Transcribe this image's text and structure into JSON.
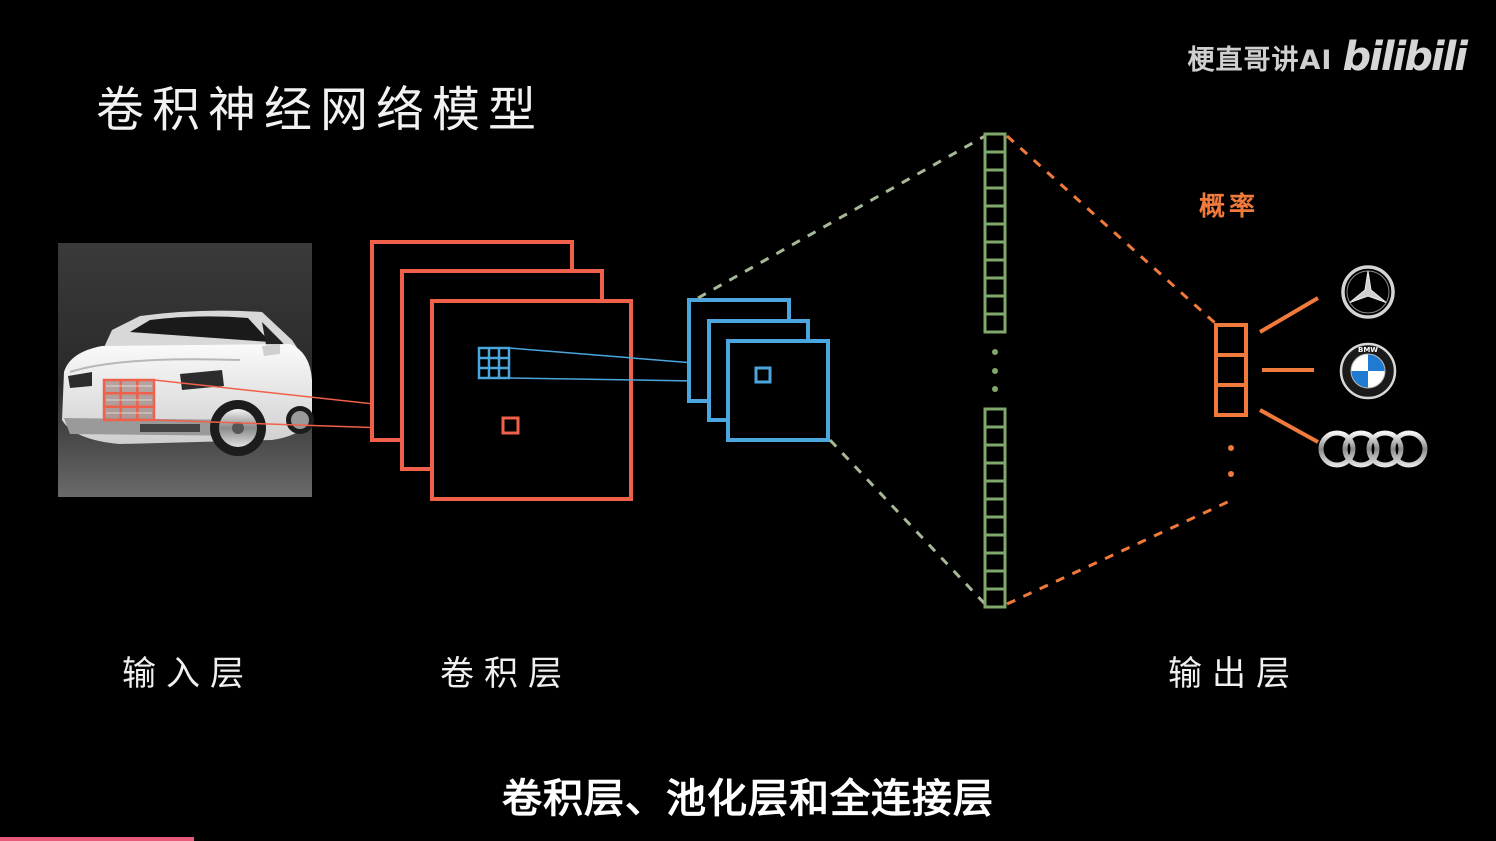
{
  "title": "卷积神经网络模型",
  "watermark": {
    "author": "梗直哥讲AI",
    "platform_logo": "bilibili"
  },
  "labels": {
    "input_layer": "输入层",
    "conv_layer": "卷积层",
    "output_layer": "输出层",
    "probability": "概率"
  },
  "subtitle": "卷积层、池化层和全连接层",
  "outputs": [
    {
      "icon": "mercedes-benz-logo-icon"
    },
    {
      "icon": "bmw-logo-icon",
      "text": "BMW"
    },
    {
      "icon": "audi-logo-icon"
    }
  ],
  "colors": {
    "background": "#000000",
    "conv_layer": "#f0604a",
    "pool_layer": "#4aa6dc",
    "fc_layer": "#7fa86a",
    "output_layer": "#f07a3c",
    "input_grid": "#f0604a",
    "progress": "#e85a7a"
  },
  "progress": {
    "fraction": 0.13
  }
}
